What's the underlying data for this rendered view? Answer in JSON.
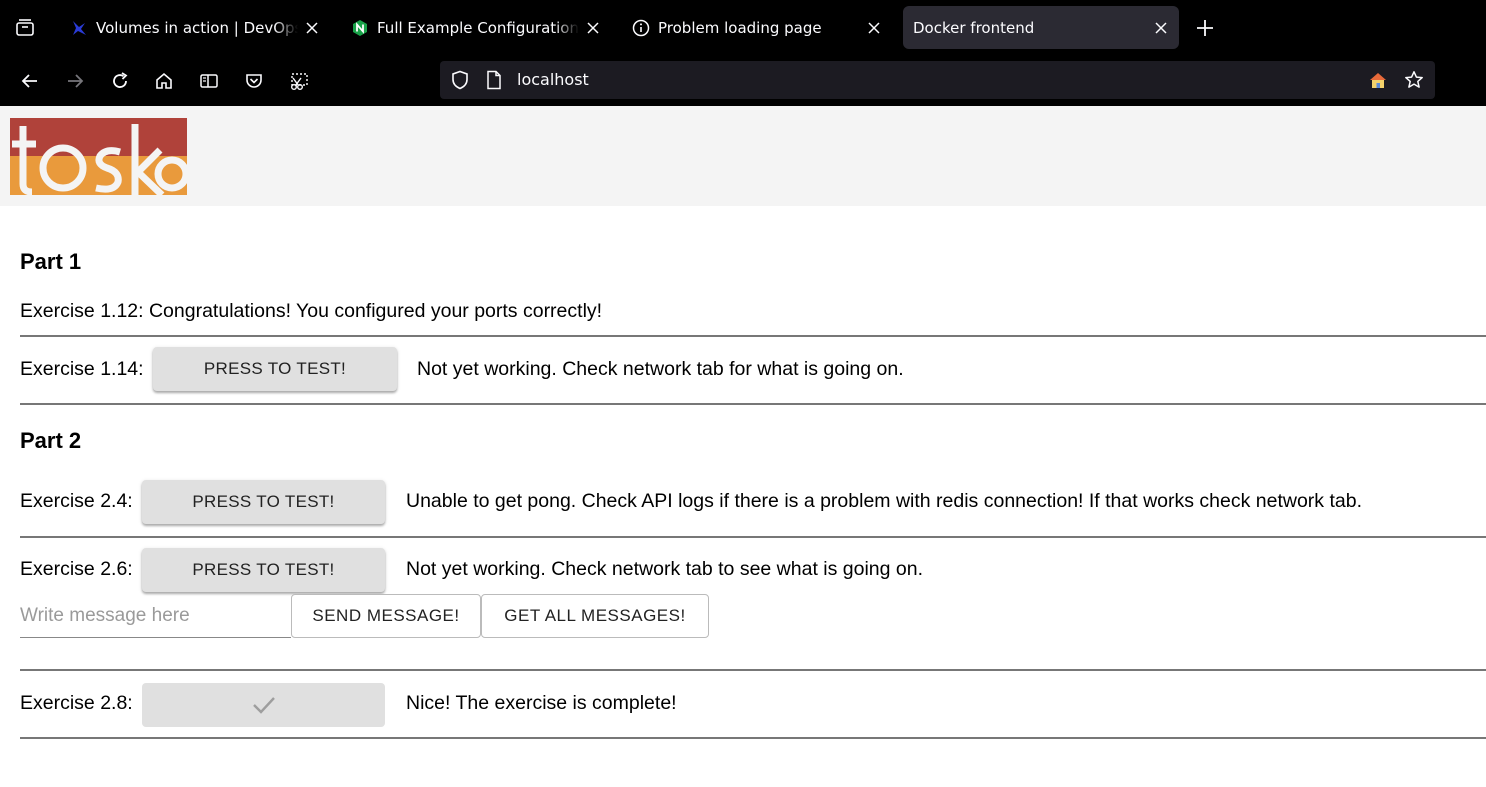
{
  "browser": {
    "tabs": [
      {
        "title": "Volumes in action | DevOps with Docker",
        "favicon": "devops-logo-icon"
      },
      {
        "title": "Full Example Configuration | NGINX",
        "favicon": "nginx-icon"
      },
      {
        "title": "Problem loading page",
        "favicon": "info-icon"
      },
      {
        "title": "Docker frontend",
        "favicon": "none"
      }
    ],
    "url": "localhost"
  },
  "page": {
    "part1": {
      "heading": "Part 1",
      "ex112": "Exercise 1.12: Congratulations! You configured your ports correctly!",
      "ex114_label": "Exercise 1.14:",
      "ex114_button": "PRESS TO TEST!",
      "ex114_status": "Not yet working. Check network tab for what is going on."
    },
    "part2": {
      "heading": "Part 2",
      "ex24_label": "Exercise 2.4:",
      "ex24_button": "PRESS TO TEST!",
      "ex24_status": "Unable to get pong. Check API logs if there is a problem with redis connection! If that works check network tab.",
      "ex26_label": "Exercise 2.6:",
      "ex26_button": "PRESS TO TEST!",
      "ex26_status": "Not yet working. Check network tab to see what is going on.",
      "message_placeholder": "Write message here",
      "send_button": "SEND MESSAGE!",
      "get_button": "GET ALL MESSAGES!",
      "ex28_label": "Exercise 2.8:",
      "ex28_status": "Nice! The exercise is complete!"
    }
  },
  "logo": {
    "text": "toska",
    "colors": {
      "top": "#b0423a",
      "bottom": "#e99a3c"
    }
  }
}
